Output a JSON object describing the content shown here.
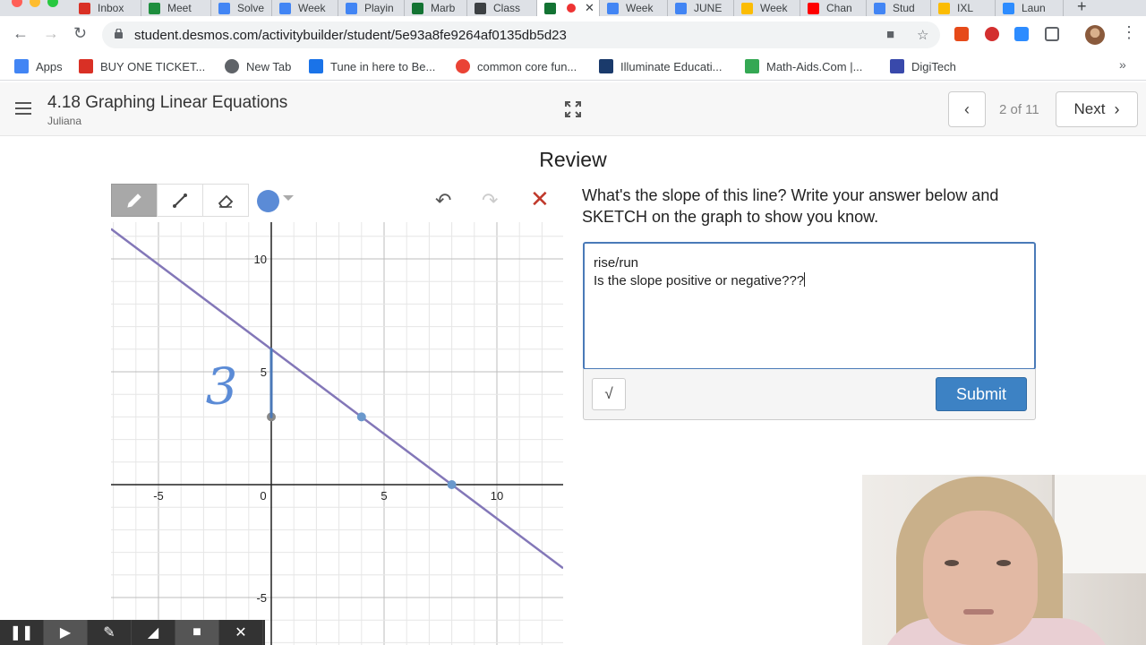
{
  "browser": {
    "tabs": [
      {
        "label": "Inbox",
        "color": "#d93025"
      },
      {
        "label": "Meet",
        "color": "#1e8e3e"
      },
      {
        "label": "Solve",
        "color": "#4285f4"
      },
      {
        "label": "Week",
        "color": "#4285f4"
      },
      {
        "label": "Playin",
        "color": "#4285f4"
      },
      {
        "label": "Marb",
        "color": "#137333"
      },
      {
        "label": "Class",
        "color": "#3c4043"
      },
      {
        "label": "",
        "color": "#137333"
      },
      {
        "label": "Week",
        "color": "#4285f4"
      },
      {
        "label": "JUNE",
        "color": "#4285f4"
      },
      {
        "label": "Week",
        "color": "#fbbc04"
      },
      {
        "label": "Chan",
        "color": "#ff0000"
      },
      {
        "label": "Stud",
        "color": "#4285f4"
      },
      {
        "label": "IXL",
        "color": "#fbbc04"
      },
      {
        "label": "Laun",
        "color": "#2d8cff"
      }
    ],
    "url": "student.desmos.com/activitybuilder/student/5e93a8fe9264af0135db5d23",
    "bookmarks": [
      {
        "label": "Apps",
        "icon": "apps-grid-icon",
        "color": "#4285f4"
      },
      {
        "label": "BUY ONE TICKET...",
        "icon": "ticket-icon",
        "color": "#d93025"
      },
      {
        "label": "New Tab",
        "icon": "globe-icon",
        "color": "#5f6368"
      },
      {
        "label": "Tune in here to Be...",
        "icon": "b-logo-icon",
        "color": "#1a73e8"
      },
      {
        "label": "common core fun...",
        "icon": "google-icon",
        "color": "#ea4335"
      },
      {
        "label": "Illuminate Educati...",
        "icon": "illuminate-icon",
        "color": "#1a3a6b"
      },
      {
        "label": "Math-Aids.Com |...",
        "icon": "math-aids-icon",
        "color": "#34a853"
      },
      {
        "label": "DigiTech",
        "icon": "digitech-icon",
        "color": "#3949ab"
      }
    ],
    "bookmarks_more": "»"
  },
  "header": {
    "activity_title": "4.18 Graphing Linear Equations",
    "student_name": "Juliana",
    "page_counter": "2 of 11",
    "next_label": "Next"
  },
  "screen": {
    "title": "Review",
    "prompt": "What's the slope of this line? Write your answer below and SKETCH on the graph to show you know.",
    "answer_lines": [
      "rise/run",
      "Is the slope positive or negative???"
    ],
    "submit_label": "Submit",
    "math_label": "√"
  },
  "sketch": {
    "active_color": "#5b8bd6",
    "handwritten_label": "3"
  },
  "graph": {
    "x_ticks": [
      "-5",
      "0",
      "5",
      "10"
    ],
    "y_ticks": [
      "10",
      "5",
      "-5"
    ],
    "line": {
      "slope": -0.75,
      "y_intercept": 6,
      "color": "#8377b8"
    },
    "points": [
      {
        "x": 0,
        "y": 3,
        "color": "#888888"
      },
      {
        "x": 4,
        "y": 3,
        "color": "#6a98cc"
      },
      {
        "x": 8,
        "y": 0,
        "color": "#6a98cc"
      }
    ]
  },
  "recording_bar": {
    "buttons": [
      "pause-icon",
      "play-icon",
      "pen-icon",
      "highlighter-icon",
      "stop-icon",
      "close-icon"
    ]
  }
}
